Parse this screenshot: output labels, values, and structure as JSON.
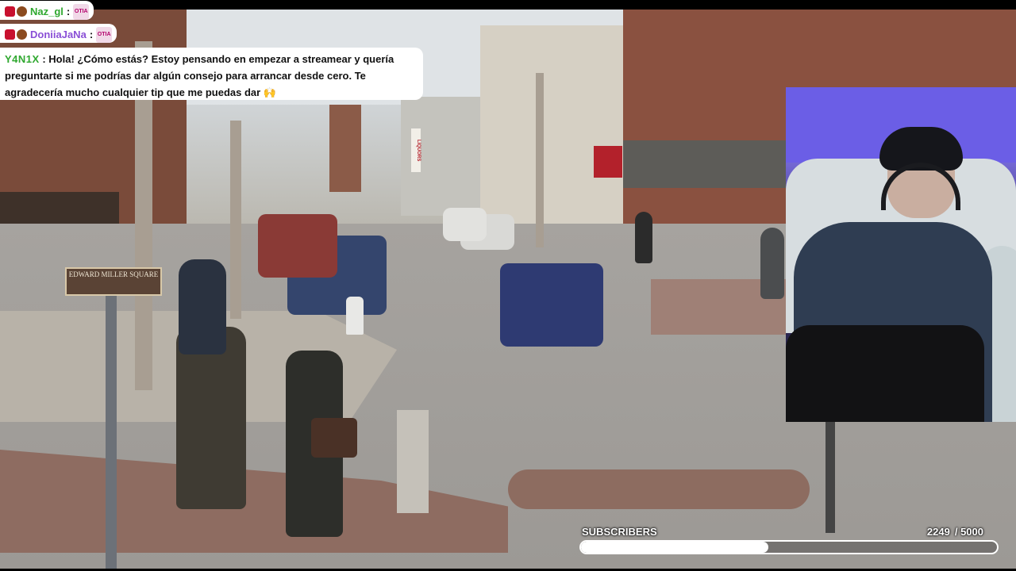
{
  "chat": {
    "messages": [
      {
        "badges": [
          "red-gem-badge",
          "bear-badge"
        ],
        "user": "Naz_gl",
        "separator": ":",
        "emote": "OTIA"
      },
      {
        "badges": [
          "red-gem-badge",
          "bear-badge"
        ],
        "user": "DoniiaJaNa",
        "separator": ":",
        "emote": "OTIA"
      },
      {
        "user": "Y4N1X",
        "separator": ":",
        "text": "Hola! ¿Cómo estás? Estoy pensando en empezar a streamear y quería preguntarte si me podrías dar algún consejo para arrancar desde cero. Te agradecería mucho cualquier tip que me puedas dar 🙌"
      }
    ]
  },
  "video": {
    "street_sign": "EDWARD MILLER SQUARE",
    "vertical_sign": "LIQUORS"
  },
  "goal": {
    "label": "SUBSCRIBERS",
    "current": "2249",
    "target": "/ 5000",
    "progress_fraction": 0.4498
  },
  "colors": {
    "username_green": "#2fa82f",
    "username_purple": "#8a4fd6",
    "webcam_backdrop": "#6b5ee6"
  }
}
